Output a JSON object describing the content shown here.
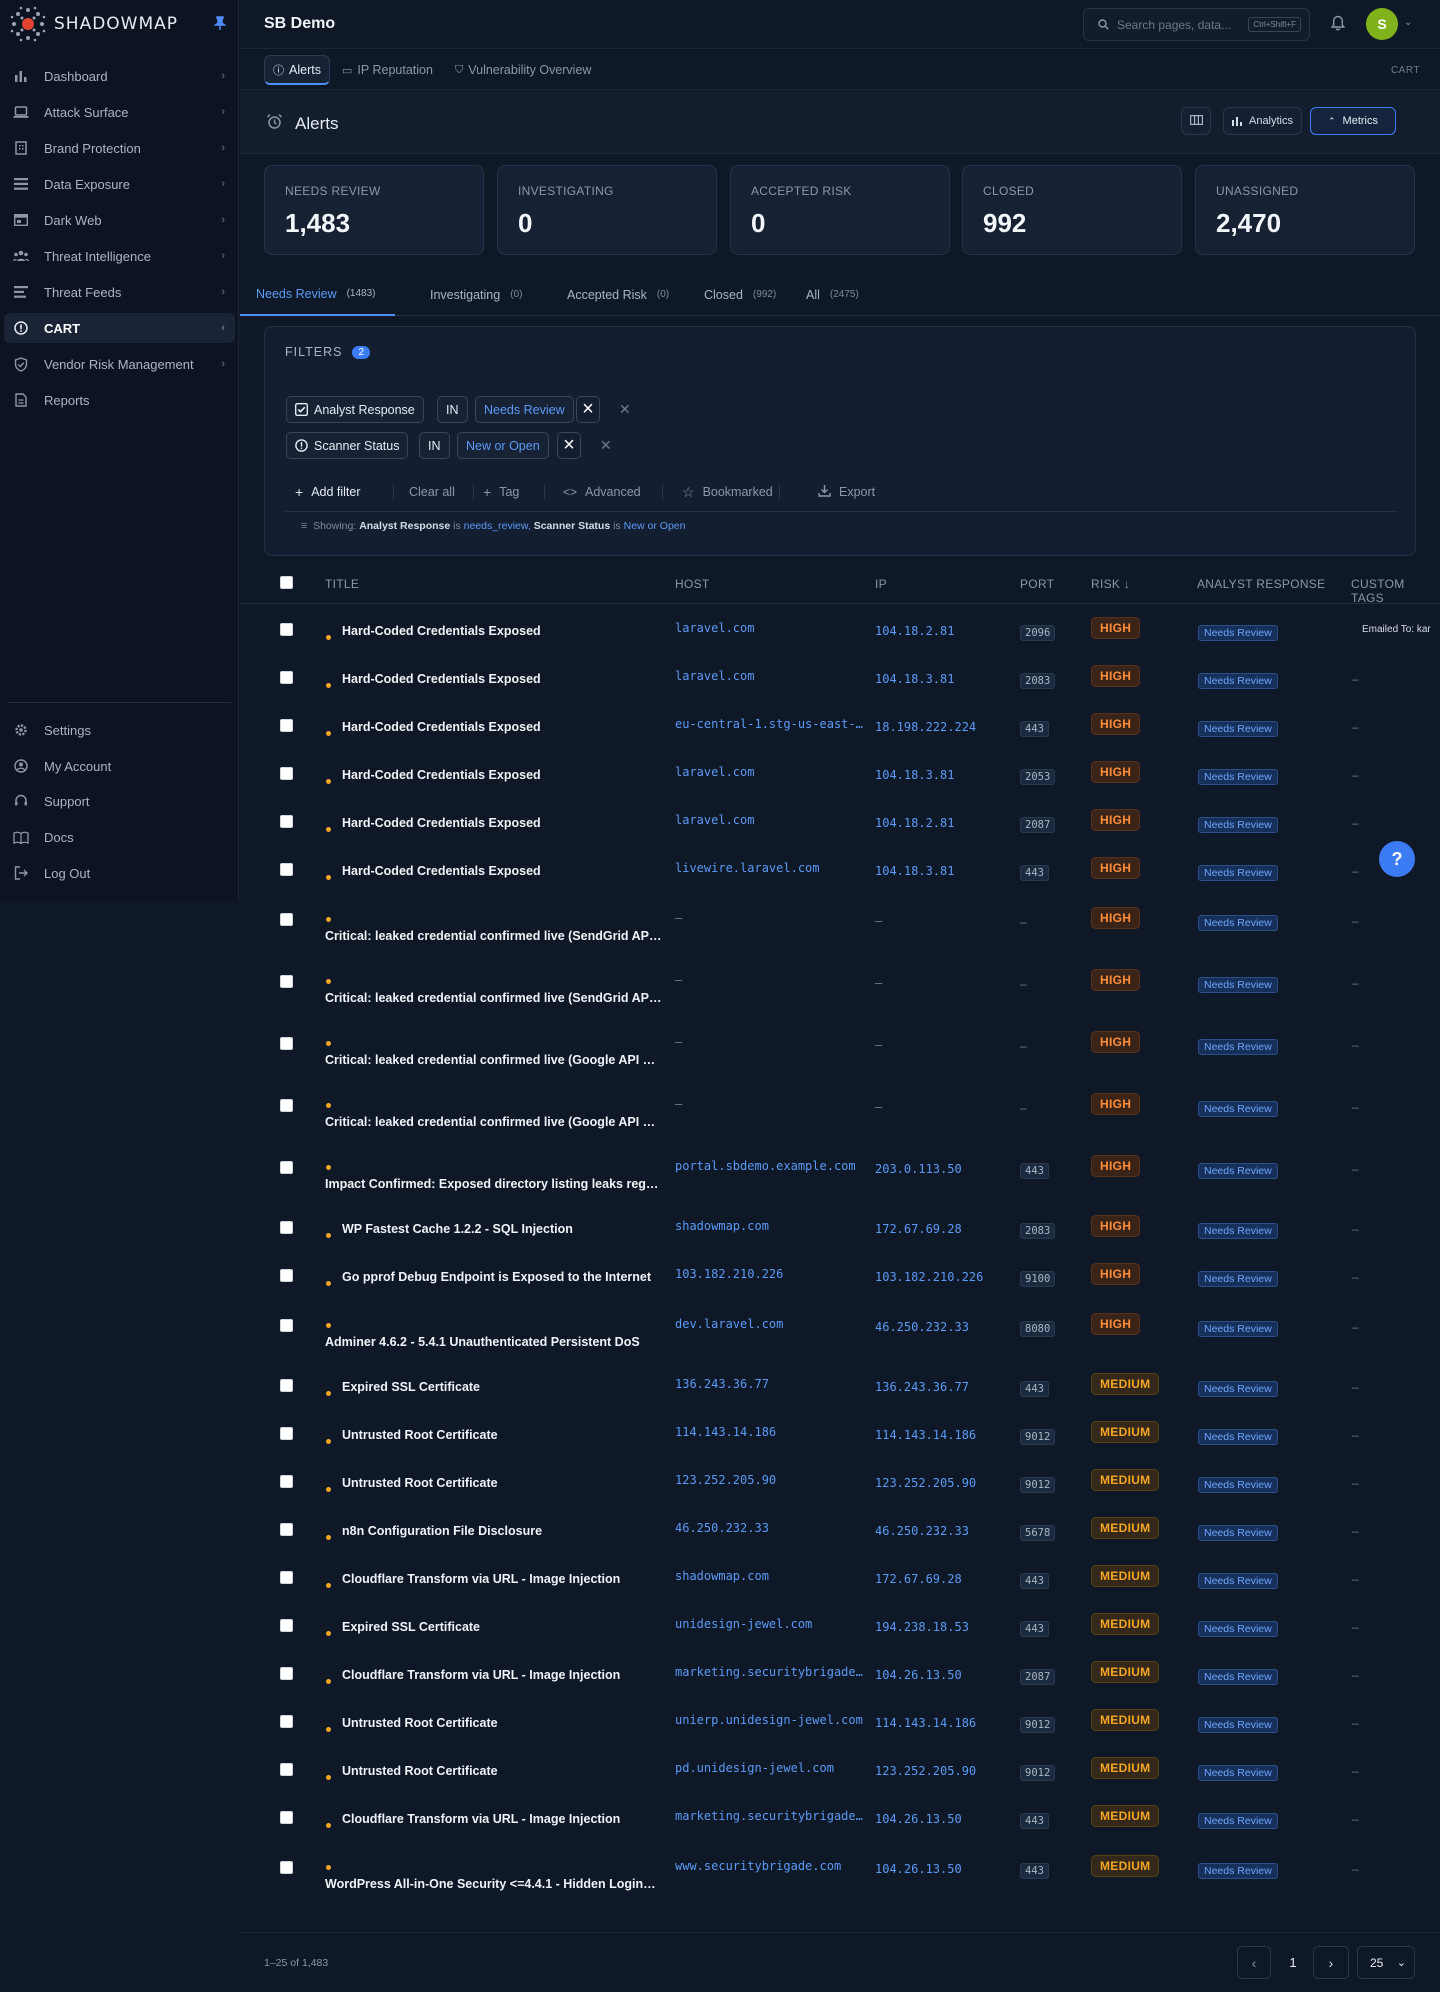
{
  "brand": {
    "name": "SHADOWMAP"
  },
  "sidebar": {
    "items": [
      {
        "label": "Dashboard",
        "icon": "bar-chart-icon",
        "chev": "›"
      },
      {
        "label": "Attack Surface",
        "icon": "laptop-icon",
        "chev": "›"
      },
      {
        "label": "Brand Protection",
        "icon": "building-icon",
        "chev": "›"
      },
      {
        "label": "Data Exposure",
        "icon": "database-icon",
        "chev": "›"
      },
      {
        "label": "Dark Web",
        "icon": "browser-icon",
        "chev": "›"
      },
      {
        "label": "Threat Intelligence",
        "icon": "users-icon",
        "chev": "›"
      },
      {
        "label": "Threat Feeds",
        "icon": "feed-icon",
        "chev": "›"
      },
      {
        "label": "CART",
        "icon": "info-circle-icon",
        "chev": "‹",
        "active": true
      },
      {
        "label": "Vendor Risk Management",
        "icon": "shield-check-icon",
        "chev": "›"
      },
      {
        "label": "Reports",
        "icon": "document-icon",
        "chev": ""
      }
    ],
    "bottom": [
      {
        "label": "Settings",
        "icon": "gear-icon"
      },
      {
        "label": "My Account",
        "icon": "user-circle-icon"
      },
      {
        "label": "Support",
        "icon": "headset-icon"
      },
      {
        "label": "Docs",
        "icon": "book-icon"
      },
      {
        "label": "Log Out",
        "icon": "logout-icon"
      }
    ]
  },
  "topbar": {
    "org": "SB Demo",
    "search_placeholder": "Search pages, data...",
    "search_kbd": "Ctrl+Shift+F",
    "avatar": "S"
  },
  "subtabs": [
    {
      "label": "Alerts",
      "icon": "info-circle-icon",
      "active": true
    },
    {
      "label": "IP Reputation",
      "icon": "card-icon"
    },
    {
      "label": "Vulnerability Overview",
      "icon": "shield-icon"
    }
  ],
  "crumb": "CART",
  "page": {
    "title": "Alerts",
    "analytics": "Analytics",
    "metrics": "Metrics"
  },
  "stats": [
    {
      "label": "NEEDS REVIEW",
      "value": "1,483"
    },
    {
      "label": "INVESTIGATING",
      "value": "0"
    },
    {
      "label": "ACCEPTED RISK",
      "value": "0"
    },
    {
      "label": "CLOSED",
      "value": "992"
    },
    {
      "label": "UNASSIGNED",
      "value": "2,470"
    }
  ],
  "tabs": [
    {
      "label": "Needs Review",
      "count": "(1483)",
      "active": true
    },
    {
      "label": "Investigating",
      "count": "(0)"
    },
    {
      "label": "Accepted Risk",
      "count": "(0)"
    },
    {
      "label": "Closed",
      "count": "(992)"
    },
    {
      "label": "All",
      "count": "(2475)"
    }
  ],
  "filters": {
    "title": "FILTERS",
    "count": "2",
    "rows": [
      {
        "field": "Analyst Response",
        "op": "IN",
        "value": "Needs Review"
      },
      {
        "field": "Scanner Status",
        "op": "IN",
        "value": "New or Open"
      }
    ],
    "actions": {
      "add": "Add filter",
      "clear": "Clear all",
      "tag": "Tag",
      "advanced": "Advanced",
      "bookmarked": "Bookmarked",
      "export": "Export"
    },
    "showing": {
      "prefix": "Showing:",
      "f1": "Analyst Response",
      "is1": "is",
      "v1": "needs_review,",
      "f2": "Scanner Status",
      "is2": "is",
      "v2": "New or Open"
    }
  },
  "table": {
    "headers": {
      "title": "TITLE",
      "host": "HOST",
      "ip": "IP",
      "port": "PORT",
      "risk": "RISK ↓",
      "response": "ANALYST RESPONSE",
      "tags": "CUSTOM TAGS"
    },
    "rows": [
      {
        "title": "Hard-Coded Credentials Exposed",
        "host": "laravel.com",
        "ip": "104.18.2.81",
        "port": "2096",
        "risk": "HIGH",
        "resp": "Needs Review",
        "tags": "Emailed To: kar"
      },
      {
        "title": "Hard-Coded Credentials Exposed",
        "host": "laravel.com",
        "ip": "104.18.3.81",
        "port": "2083",
        "risk": "HIGH",
        "resp": "Needs Review",
        "tags": "–"
      },
      {
        "title": "Hard-Coded Credentials Exposed",
        "host": "eu-central-1.stg-us-east-…",
        "ip": "18.198.222.224",
        "port": "443",
        "risk": "HIGH",
        "resp": "Needs Review",
        "tags": "–"
      },
      {
        "title": "Hard-Coded Credentials Exposed",
        "host": "laravel.com",
        "ip": "104.18.3.81",
        "port": "2053",
        "risk": "HIGH",
        "resp": "Needs Review",
        "tags": "–"
      },
      {
        "title": "Hard-Coded Credentials Exposed",
        "host": "laravel.com",
        "ip": "104.18.2.81",
        "port": "2087",
        "risk": "HIGH",
        "resp": "Needs Review",
        "tags": "–"
      },
      {
        "title": "Hard-Coded Credentials Exposed",
        "host": "livewire.laravel.com",
        "ip": "104.18.3.81",
        "port": "443",
        "risk": "HIGH",
        "resp": "Needs Review",
        "tags": "–"
      },
      {
        "title": "Critical: leaked credential confirmed live (SendGrid AP…",
        "host": "–",
        "ip": "–",
        "port": "–",
        "risk": "HIGH",
        "resp": "Needs Review",
        "tags": "–",
        "wrap": true
      },
      {
        "title": "Critical: leaked credential confirmed live (SendGrid AP…",
        "host": "–",
        "ip": "–",
        "port": "–",
        "risk": "HIGH",
        "resp": "Needs Review",
        "tags": "–",
        "wrap": true
      },
      {
        "title": "Critical: leaked credential confirmed live (Google API …",
        "host": "–",
        "ip": "–",
        "port": "–",
        "risk": "HIGH",
        "resp": "Needs Review",
        "tags": "–",
        "wrap": true
      },
      {
        "title": "Critical: leaked credential confirmed live (Google API …",
        "host": "–",
        "ip": "–",
        "port": "–",
        "risk": "HIGH",
        "resp": "Needs Review",
        "tags": "–",
        "wrap": true
      },
      {
        "title": "Impact Confirmed: Exposed directory listing leaks reg…",
        "host": "portal.sbdemo.example.com",
        "ip": "203.0.113.50",
        "port": "443",
        "risk": "HIGH",
        "resp": "Needs Review",
        "tags": "–",
        "wrap": true
      },
      {
        "title": "WP Fastest Cache 1.2.2 - SQL Injection",
        "host": "shadowmap.com",
        "ip": "172.67.69.28",
        "port": "2083",
        "risk": "HIGH",
        "resp": "Needs Review",
        "tags": "–"
      },
      {
        "title": "Go pprof Debug Endpoint is Exposed to the Internet",
        "host": "103.182.210.226",
        "ip": "103.182.210.226",
        "port": "9100",
        "risk": "HIGH",
        "resp": "Needs Review",
        "tags": "–"
      },
      {
        "title": "Adminer 4.6.2 - 5.4.1 Unauthenticated Persistent DoS",
        "host": "dev.laravel.com",
        "ip": "46.250.232.33",
        "port": "8080",
        "risk": "HIGH",
        "resp": "Needs Review",
        "tags": "–",
        "wrap": true
      },
      {
        "title": "Expired SSL Certificate",
        "host": "136.243.36.77",
        "ip": "136.243.36.77",
        "port": "443",
        "risk": "MEDIUM",
        "resp": "Needs Review",
        "tags": "–"
      },
      {
        "title": "Untrusted Root Certificate",
        "host": "114.143.14.186",
        "ip": "114.143.14.186",
        "port": "9012",
        "risk": "MEDIUM",
        "resp": "Needs Review",
        "tags": "–"
      },
      {
        "title": "Untrusted Root Certificate",
        "host": "123.252.205.90",
        "ip": "123.252.205.90",
        "port": "9012",
        "risk": "MEDIUM",
        "resp": "Needs Review",
        "tags": "–"
      },
      {
        "title": "n8n Configuration File Disclosure",
        "host": "46.250.232.33",
        "ip": "46.250.232.33",
        "port": "5678",
        "risk": "MEDIUM",
        "resp": "Needs Review",
        "tags": "–"
      },
      {
        "title": "Cloudflare Transform via URL - Image Injection",
        "host": "shadowmap.com",
        "ip": "172.67.69.28",
        "port": "443",
        "risk": "MEDIUM",
        "resp": "Needs Review",
        "tags": "–"
      },
      {
        "title": "Expired SSL Certificate",
        "host": "unidesign-jewel.com",
        "ip": "194.238.18.53",
        "port": "443",
        "risk": "MEDIUM",
        "resp": "Needs Review",
        "tags": "–"
      },
      {
        "title": "Cloudflare Transform via URL - Image Injection",
        "host": "marketing.securitybrigade…",
        "ip": "104.26.13.50",
        "port": "2087",
        "risk": "MEDIUM",
        "resp": "Needs Review",
        "tags": "–"
      },
      {
        "title": "Untrusted Root Certificate",
        "host": "unierp.unidesign-jewel.com",
        "ip": "114.143.14.186",
        "port": "9012",
        "risk": "MEDIUM",
        "resp": "Needs Review",
        "tags": "–"
      },
      {
        "title": "Untrusted Root Certificate",
        "host": "pd.unidesign-jewel.com",
        "ip": "123.252.205.90",
        "port": "9012",
        "risk": "MEDIUM",
        "resp": "Needs Review",
        "tags": "–"
      },
      {
        "title": "Cloudflare Transform via URL - Image Injection",
        "host": "marketing.securitybrigade…",
        "ip": "104.26.13.50",
        "port": "443",
        "risk": "MEDIUM",
        "resp": "Needs Review",
        "tags": "–"
      },
      {
        "title": "WordPress All-in-One Security <=4.4.1 - Hidden Login…",
        "host": "www.securitybrigade.com",
        "ip": "104.26.13.50",
        "port": "443",
        "risk": "MEDIUM",
        "resp": "Needs Review",
        "tags": "–",
        "wrap": true
      }
    ]
  },
  "help": "?",
  "pager": {
    "range": "1–25 of 1,483",
    "page": "1",
    "per_page": "25"
  }
}
